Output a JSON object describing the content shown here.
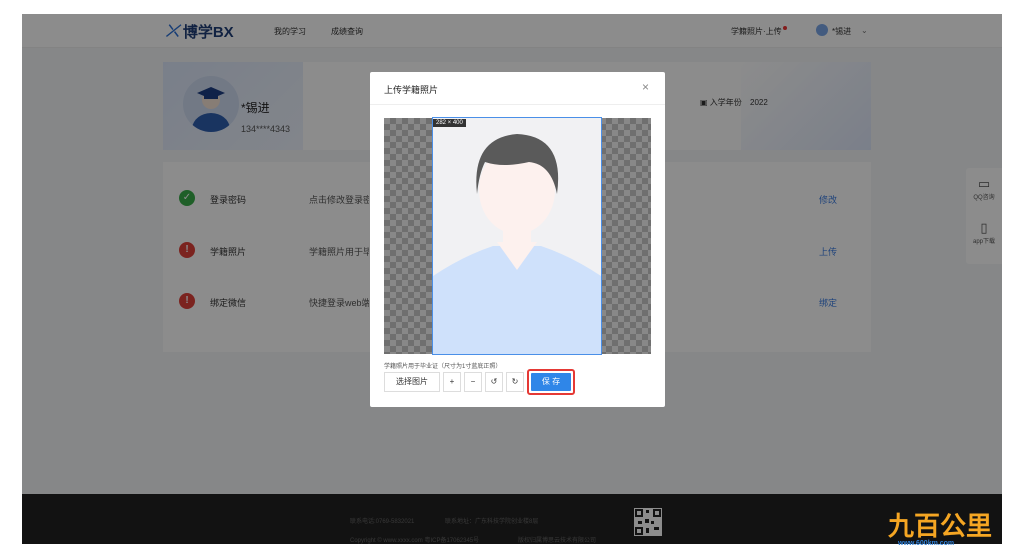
{
  "header": {
    "logo_text": "博学BX",
    "nav": [
      "我的学习",
      "成绩查询"
    ],
    "photo_upload_link": "学籍照片·上传",
    "user_name": "*锡进"
  },
  "profile": {
    "name": "*锡进",
    "phone": "134****4343",
    "year_label": "入学年份",
    "year_value": "2022"
  },
  "security": [
    {
      "label": "登录密码",
      "desc": "点击修改登录密",
      "action": "修改",
      "status": "ok",
      "color": "#3aad4a"
    },
    {
      "label": "学籍照片",
      "desc": "学籍照片用于毕",
      "action": "上传",
      "status": "warn",
      "color": "#e0403a"
    },
    {
      "label": "绑定微信",
      "desc": "快捷登录web端",
      "action": "绑定",
      "status": "warn",
      "color": "#e0403a"
    }
  ],
  "side": {
    "qq": "QQ咨询",
    "app": "app下载"
  },
  "footer": {
    "line1_phone": "联系电话:0769-5832021",
    "line1_addr": "联系地址：广东科技学院创业楼8层",
    "line2_copy": "Copyright © www.xxxx.com 粤ICP备17062345号",
    "line2_company": "版权归属博思云技术有限公司"
  },
  "modal": {
    "title": "上传学籍照片",
    "close": "×",
    "dimension": "282 × 400",
    "hint": "学籍照片用于毕业证（尺寸为1寸蓝底正照）",
    "choose_label": "选择图片",
    "zoom_in": "+",
    "zoom_out": "−",
    "rotate_left": "↺",
    "rotate_right": "↻",
    "save_label": "保 存"
  },
  "watermark": {
    "brand": "九百公里",
    "url": "www.600km.com"
  },
  "colors": {
    "accent": "#2f86e8",
    "highlight": "#e53935"
  }
}
